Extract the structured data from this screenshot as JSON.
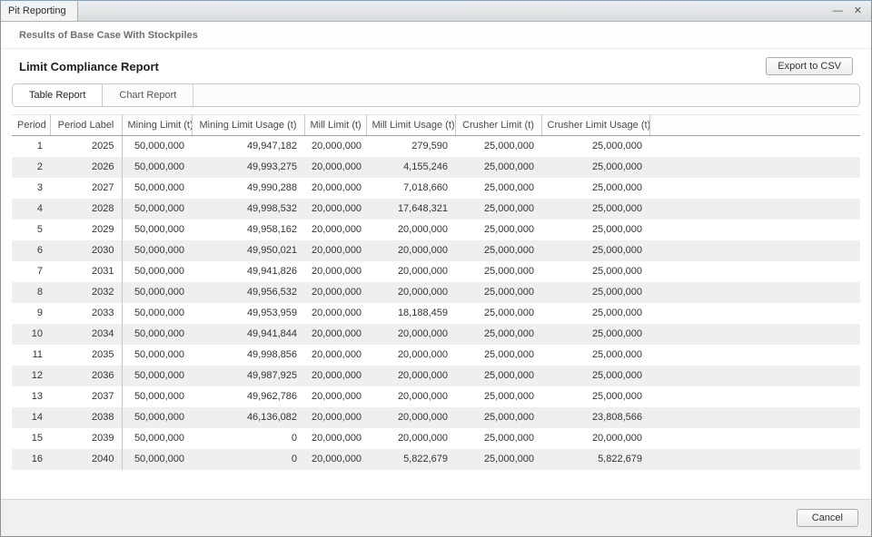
{
  "window": {
    "title": "Pit Reporting",
    "minimize_glyph": "—",
    "close_glyph": "✕"
  },
  "header": {
    "subtitle": "Results of Base Case With Stockpiles"
  },
  "report": {
    "title": "Limit Compliance Report",
    "export_label": "Export to CSV"
  },
  "active_tab": "Table Report",
  "tabs": [
    {
      "label": "Table Report"
    },
    {
      "label": "Chart Report"
    }
  ],
  "table": {
    "columns": [
      "Period",
      "Period Label",
      "Mining Limit (t)",
      "Mining Limit Usage (t)",
      "Mill Limit (t)",
      "Mill Limit Usage (t)",
      "Crusher Limit (t)",
      "Crusher Limit Usage (t)"
    ],
    "rows": [
      [
        "1",
        "2025",
        "50,000,000",
        "49,947,182",
        "20,000,000",
        "279,590",
        "25,000,000",
        "25,000,000"
      ],
      [
        "2",
        "2026",
        "50,000,000",
        "49,993,275",
        "20,000,000",
        "4,155,246",
        "25,000,000",
        "25,000,000"
      ],
      [
        "3",
        "2027",
        "50,000,000",
        "49,990,288",
        "20,000,000",
        "7,018,660",
        "25,000,000",
        "25,000,000"
      ],
      [
        "4",
        "2028",
        "50,000,000",
        "49,998,532",
        "20,000,000",
        "17,648,321",
        "25,000,000",
        "25,000,000"
      ],
      [
        "5",
        "2029",
        "50,000,000",
        "49,958,162",
        "20,000,000",
        "20,000,000",
        "25,000,000",
        "25,000,000"
      ],
      [
        "6",
        "2030",
        "50,000,000",
        "49,950,021",
        "20,000,000",
        "20,000,000",
        "25,000,000",
        "25,000,000"
      ],
      [
        "7",
        "2031",
        "50,000,000",
        "49,941,826",
        "20,000,000",
        "20,000,000",
        "25,000,000",
        "25,000,000"
      ],
      [
        "8",
        "2032",
        "50,000,000",
        "49,956,532",
        "20,000,000",
        "20,000,000",
        "25,000,000",
        "25,000,000"
      ],
      [
        "9",
        "2033",
        "50,000,000",
        "49,953,959",
        "20,000,000",
        "18,188,459",
        "25,000,000",
        "25,000,000"
      ],
      [
        "10",
        "2034",
        "50,000,000",
        "49,941,844",
        "20,000,000",
        "20,000,000",
        "25,000,000",
        "25,000,000"
      ],
      [
        "11",
        "2035",
        "50,000,000",
        "49,998,856",
        "20,000,000",
        "20,000,000",
        "25,000,000",
        "25,000,000"
      ],
      [
        "12",
        "2036",
        "50,000,000",
        "49,987,925",
        "20,000,000",
        "20,000,000",
        "25,000,000",
        "25,000,000"
      ],
      [
        "13",
        "2037",
        "50,000,000",
        "49,962,786",
        "20,000,000",
        "20,000,000",
        "25,000,000",
        "25,000,000"
      ],
      [
        "14",
        "2038",
        "50,000,000",
        "46,136,082",
        "20,000,000",
        "20,000,000",
        "25,000,000",
        "23,808,566"
      ],
      [
        "15",
        "2039",
        "50,000,000",
        "0",
        "20,000,000",
        "20,000,000",
        "25,000,000",
        "20,000,000"
      ],
      [
        "16",
        "2040",
        "50,000,000",
        "0",
        "20,000,000",
        "5,822,679",
        "25,000,000",
        "5,822,679"
      ]
    ]
  },
  "footer": {
    "cancel_label": "Cancel"
  }
}
